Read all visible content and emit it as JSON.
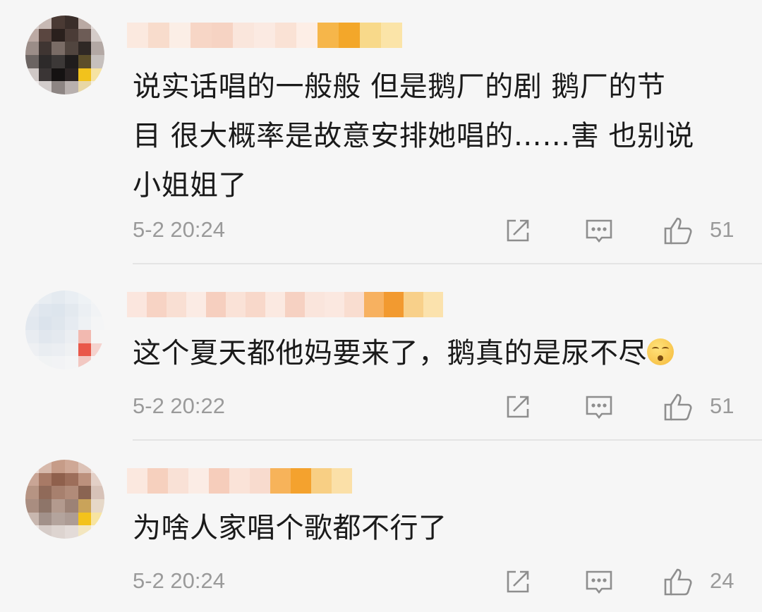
{
  "comments": [
    {
      "text_lines": [
        "说实话唱的一般般 但是鹅厂的剧 鹅厂的节",
        "目 很大概率是故意安排她唱的……害 也别说",
        "小姐姐了"
      ],
      "time": "5-2 20:24",
      "likes": "51"
    },
    {
      "text_lines": [
        "这个夏天都他妈要来了，鹅真的是尿不尽"
      ],
      "time": "5-2 20:22",
      "likes": "51"
    },
    {
      "text_lines": [
        "为啥人家唱个歌都不行了"
      ],
      "time": "5-2 20:24",
      "likes": "24"
    }
  ],
  "icons": {
    "share": "share-icon",
    "comment": "comment-icon",
    "like": "thumbs-up-icon"
  },
  "colors": {
    "background": "#f6f6f6",
    "text": "#1a1a1a",
    "meta": "#9a9a9a",
    "divider": "#e4e4e4"
  }
}
